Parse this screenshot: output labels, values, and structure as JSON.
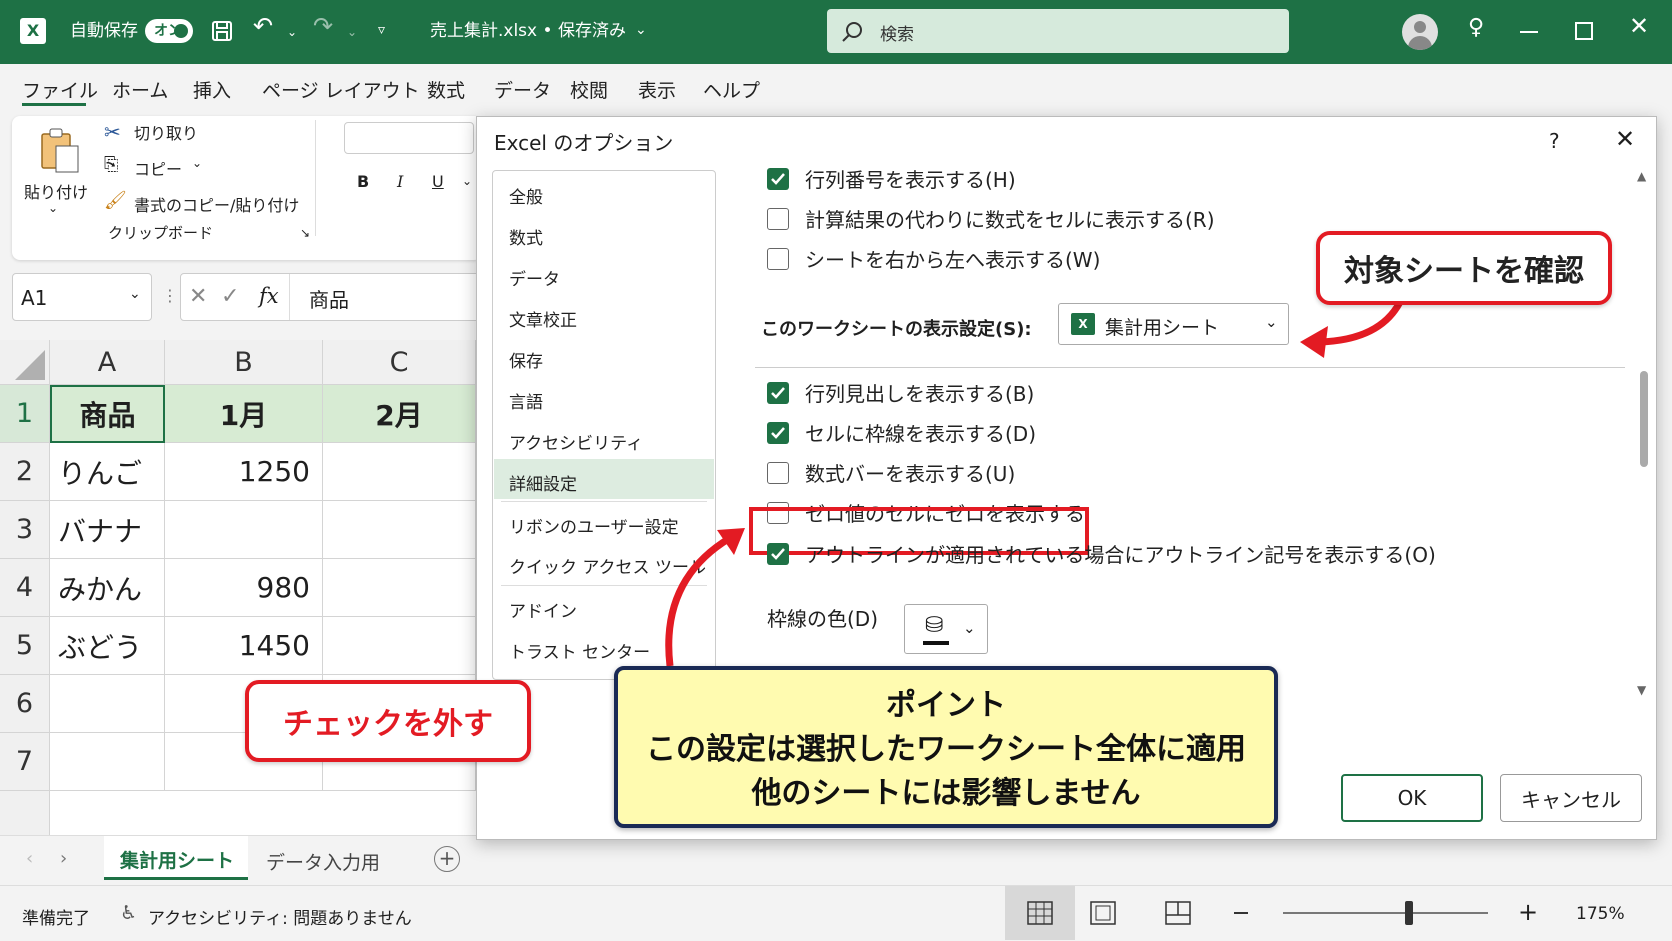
{
  "titlebar": {
    "autosave_label": "自動保存",
    "autosave_state": "オン",
    "filename": "売上集計.xlsx • 保存済み",
    "search_placeholder": "検索"
  },
  "menu": [
    "ファイル",
    "ホーム",
    "挿入",
    "ページ レイアウト",
    "数式",
    "データ",
    "校閲",
    "表示",
    "ヘルプ"
  ],
  "ribbon": {
    "paste": "貼り付け",
    "cut": "切り取り",
    "copy": "コピー",
    "format_painter": "書式のコピー/貼り付け",
    "group": "クリップボード",
    "bold": "B",
    "italic": "I",
    "underline": "U"
  },
  "formula": {
    "name_box": "A1",
    "fx": "fx",
    "value": "商品"
  },
  "grid": {
    "columns": [
      "A",
      "B",
      "C"
    ],
    "rows": [
      {
        "num": "1",
        "a": "商品",
        "b": "1月",
        "c": "2月"
      },
      {
        "num": "2",
        "a": "りんご",
        "b": "1250",
        "c": ""
      },
      {
        "num": "3",
        "a": "バナナ",
        "b": "",
        "c": ""
      },
      {
        "num": "4",
        "a": "みかん",
        "b": "980",
        "c": ""
      },
      {
        "num": "5",
        "a": "ぶどう",
        "b": "1450",
        "c": ""
      },
      {
        "num": "6",
        "a": "",
        "b": "",
        "c": ""
      },
      {
        "num": "7",
        "a": "",
        "b": "",
        "c": ""
      }
    ]
  },
  "sheets": {
    "active": "集計用シート",
    "other": "データ入力用"
  },
  "status": {
    "ready": "準備完了",
    "accessibility": "アクセシビリティ: 問題ありません",
    "zoom": "175%"
  },
  "dialog": {
    "title": "Excel のオプション",
    "help": "?",
    "categories": [
      "全般",
      "数式",
      "データ",
      "文章校正",
      "保存",
      "言語",
      "アクセシビリティ",
      "詳細設定",
      "リボンのユーザー設定",
      "クイック アクセス ツール バー",
      "アドイン",
      "トラスト センター"
    ],
    "selected_category": "詳細設定",
    "options_top": [
      {
        "label": "行列番号を表示する(H)",
        "checked": true
      },
      {
        "label": "計算結果の代わりに数式をセルに表示する(R)",
        "checked": false
      },
      {
        "label": "シートを右から左へ表示する(W)",
        "checked": false
      }
    ],
    "sheet_setting_label": "このワークシートの表示設定(S):",
    "sheet_setting_value": "集計用シート",
    "options_bottom": [
      {
        "label": "行列見出しを表示する(B)",
        "checked": true
      },
      {
        "label": "セルに枠線を表示する(D)",
        "checked": true
      },
      {
        "label": "数式バーを表示する(U)",
        "checked": false
      },
      {
        "label": "ゼロ値のセルにゼロを表示する",
        "checked": false
      },
      {
        "label": "アウトラインが適用されている場合にアウトライン記号を表示する(O)",
        "checked": true
      }
    ],
    "gridline_color_label": "枠線の色(D)",
    "ok": "OK",
    "cancel": "キャンセル"
  },
  "callouts": {
    "target_sheet": "対象シートを確認",
    "uncheck": "チェックを外す",
    "point_title": "ポイント",
    "point_line1": "この設定は選択したワークシート全体に適用",
    "point_line2": "他のシートには影響しません"
  },
  "colors": {
    "excel_green": "#1e7145",
    "highlight_red": "#e31b23",
    "point_bg": "#fffbb0"
  }
}
